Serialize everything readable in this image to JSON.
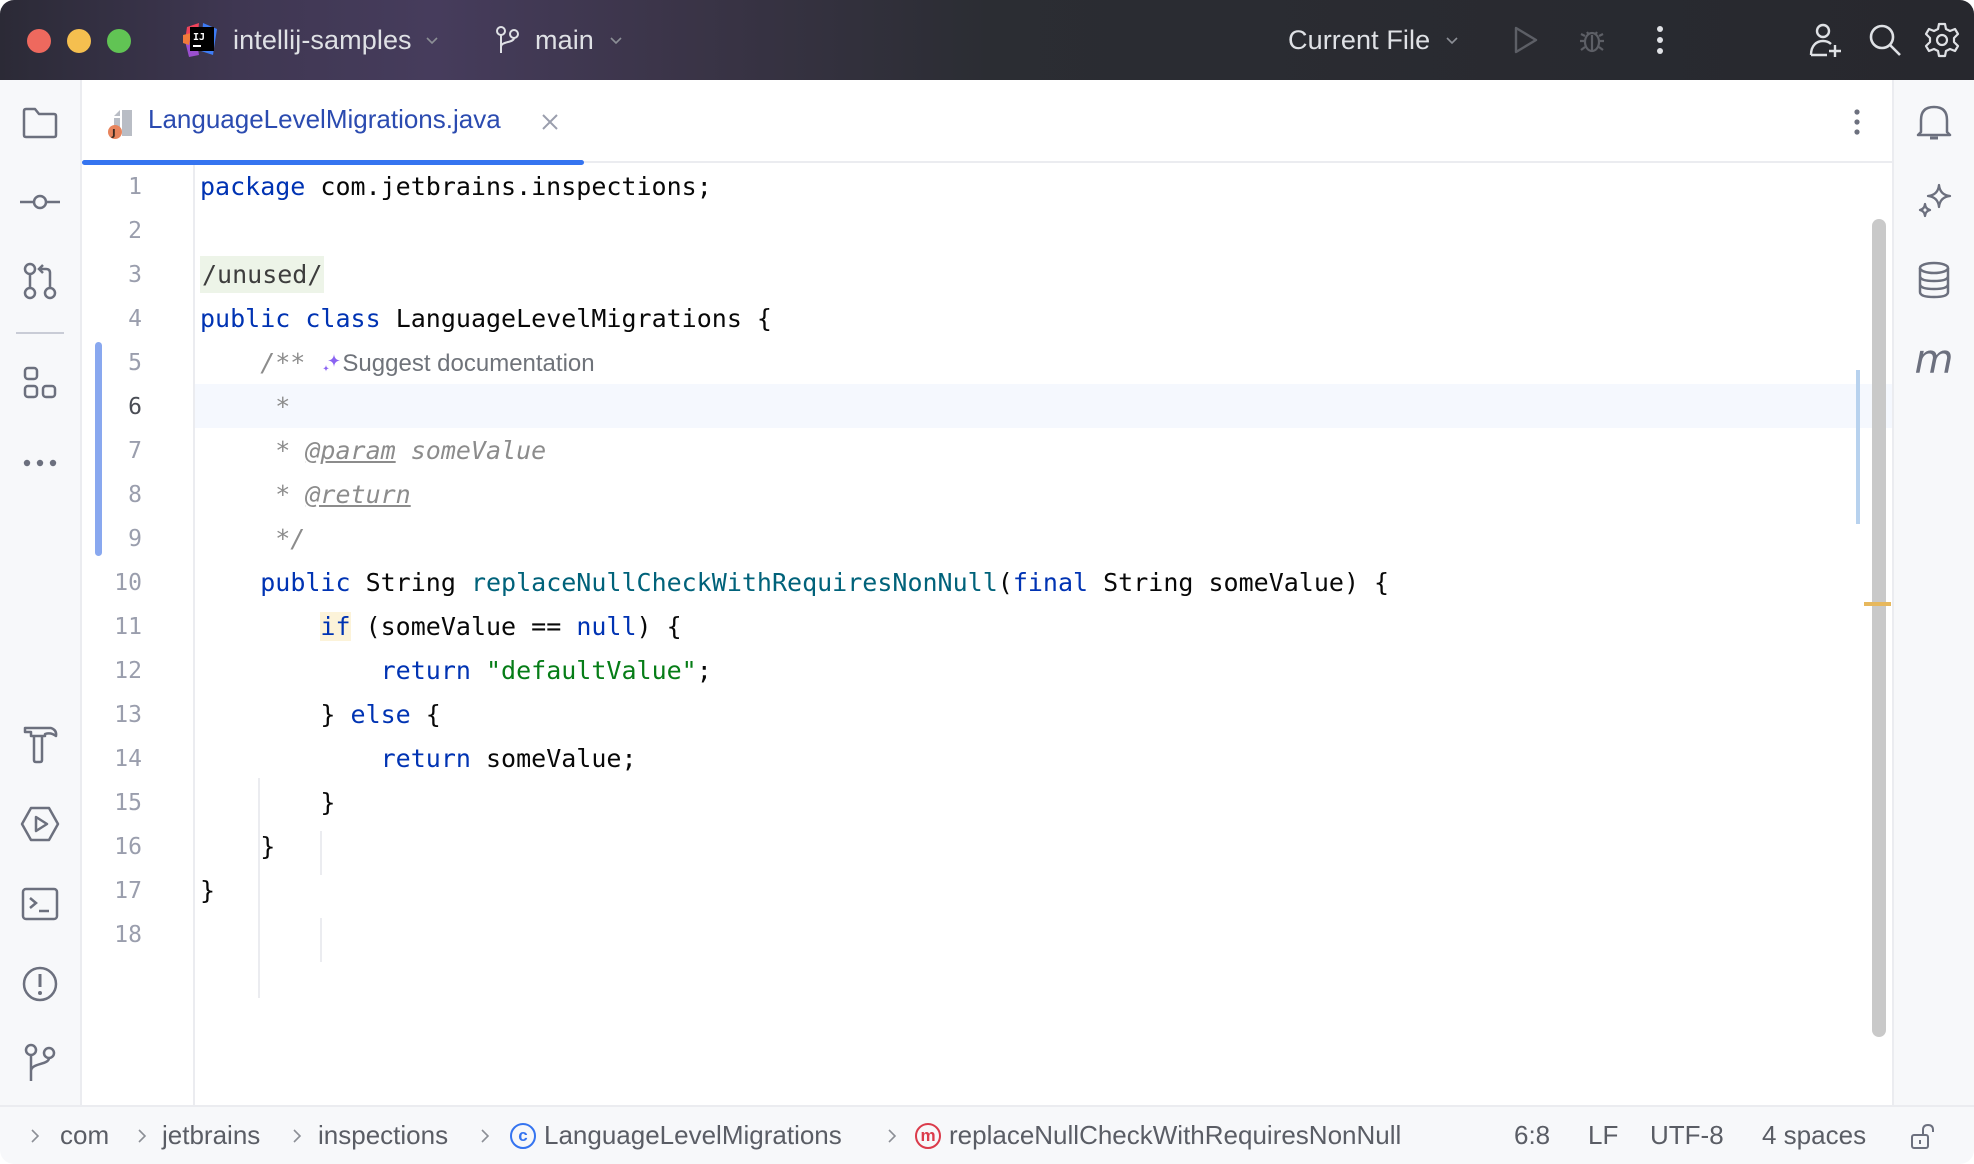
{
  "titlebar": {
    "project_name": "intellij-samples",
    "branch_name": "main",
    "run_config": "Current File",
    "icons": [
      "add-user-icon",
      "search-icon",
      "settings-gear-icon"
    ]
  },
  "left_toolbar": {
    "items": [
      {
        "name": "project",
        "icon": "folder-icon"
      },
      {
        "name": "commit",
        "icon": "commit-icon"
      },
      {
        "name": "pull-requests",
        "icon": "pull-request-icon"
      },
      {
        "name": "structure",
        "icon": "structure-icon"
      },
      {
        "name": "more",
        "icon": "more-horizontal-icon"
      },
      {
        "name": "build",
        "icon": "hammer-icon"
      },
      {
        "name": "services",
        "icon": "services-run-icon"
      },
      {
        "name": "terminal",
        "icon": "terminal-icon"
      },
      {
        "name": "problems",
        "icon": "problems-icon"
      },
      {
        "name": "git",
        "icon": "git-branch-icon"
      }
    ]
  },
  "right_toolbar": {
    "items": [
      {
        "name": "notifications",
        "icon": "bell-icon"
      },
      {
        "name": "ai-assistant",
        "icon": "ai-sparkle-icon"
      },
      {
        "name": "database",
        "icon": "database-icon"
      },
      {
        "name": "maven",
        "icon": "maven-m-icon"
      }
    ]
  },
  "editor": {
    "tab": {
      "label": "LanguageLevelMigrations.java",
      "active": true
    },
    "current_line": 6,
    "hint_text": "Suggest documentation",
    "line_numbers": [
      "1",
      "2",
      "3",
      "4",
      "5",
      "6",
      "7",
      "8",
      "9",
      "10",
      "11",
      "12",
      "13",
      "14",
      "15",
      "16",
      "17",
      "18"
    ],
    "lines": [
      {
        "n": 1,
        "tokens": [
          {
            "t": "package",
            "c": "kw"
          },
          {
            "t": " com.jetbrains.inspections;",
            "c": ""
          }
        ]
      },
      {
        "n": 2,
        "tokens": []
      },
      {
        "n": 3,
        "tokens": [
          {
            "t": "/unused/",
            "c": "unused"
          }
        ]
      },
      {
        "n": 4,
        "tokens": [
          {
            "t": "public",
            "c": "kw"
          },
          {
            "t": " ",
            "c": ""
          },
          {
            "t": "class",
            "c": "kw"
          },
          {
            "t": " LanguageLevelMigrations {",
            "c": ""
          }
        ]
      },
      {
        "n": 5,
        "tokens": [
          {
            "t": "    /** ",
            "c": "cmt"
          },
          {
            "t": "HINT",
            "c": "hint"
          }
        ]
      },
      {
        "n": 6,
        "tokens": [
          {
            "t": "     *",
            "c": "cmt"
          }
        ]
      },
      {
        "n": 7,
        "tokens": [
          {
            "t": "     * ",
            "c": "cmt"
          },
          {
            "t": "@param",
            "c": "tag"
          },
          {
            "t": " someValue",
            "c": "cmt"
          }
        ]
      },
      {
        "n": 8,
        "tokens": [
          {
            "t": "     * ",
            "c": "cmt"
          },
          {
            "t": "@return",
            "c": "tag"
          }
        ]
      },
      {
        "n": 9,
        "tokens": [
          {
            "t": "     */",
            "c": "cmt"
          }
        ]
      },
      {
        "n": 10,
        "tokens": [
          {
            "t": "    ",
            "c": ""
          },
          {
            "t": "public",
            "c": "kw"
          },
          {
            "t": " String ",
            "c": ""
          },
          {
            "t": "replaceNullCheckWithRequiresNonNull",
            "c": "fn"
          },
          {
            "t": "(",
            "c": ""
          },
          {
            "t": "final",
            "c": "kw"
          },
          {
            "t": " String someValue) {",
            "c": ""
          }
        ]
      },
      {
        "n": 11,
        "tokens": [
          {
            "t": "        ",
            "c": ""
          },
          {
            "t": "if",
            "c": "kw if-hl"
          },
          {
            "t": " (someValue == ",
            "c": ""
          },
          {
            "t": "null",
            "c": "kw"
          },
          {
            "t": ") {",
            "c": ""
          }
        ]
      },
      {
        "n": 12,
        "tokens": [
          {
            "t": "            ",
            "c": ""
          },
          {
            "t": "return",
            "c": "kw"
          },
          {
            "t": " ",
            "c": ""
          },
          {
            "t": "\"defaultValue\"",
            "c": "str"
          },
          {
            "t": ";",
            "c": ""
          }
        ]
      },
      {
        "n": 13,
        "tokens": [
          {
            "t": "        } ",
            "c": ""
          },
          {
            "t": "else",
            "c": "kw"
          },
          {
            "t": " {",
            "c": ""
          }
        ]
      },
      {
        "n": 14,
        "tokens": [
          {
            "t": "            ",
            "c": ""
          },
          {
            "t": "return",
            "c": "kw"
          },
          {
            "t": " someValue;",
            "c": ""
          }
        ]
      },
      {
        "n": 15,
        "tokens": [
          {
            "t": "        }",
            "c": ""
          }
        ]
      },
      {
        "n": 16,
        "tokens": [
          {
            "t": "    }",
            "c": ""
          }
        ]
      },
      {
        "n": 17,
        "tokens": [
          {
            "t": "}",
            "c": ""
          }
        ]
      },
      {
        "n": 18,
        "tokens": []
      }
    ]
  },
  "statusbar": {
    "breadcrumbs": [
      {
        "label": "com",
        "badge": null
      },
      {
        "label": "jetbrains",
        "badge": null
      },
      {
        "label": "inspections",
        "badge": null
      },
      {
        "label": "LanguageLevelMigrations",
        "badge": "c"
      },
      {
        "label": "replaceNullCheckWithRequiresNonNull",
        "badge": "m"
      }
    ],
    "caret_position": "6:8",
    "line_separator": "LF",
    "encoding": "UTF-8",
    "indent": "4 spaces",
    "readonly_icon": "unlocked-icon"
  },
  "colors": {
    "accent": "#3574f0",
    "keyword": "#0033b3",
    "method": "#00627a",
    "string": "#067d17",
    "comment": "#8c8c8c",
    "warning": "#e7b85d"
  }
}
